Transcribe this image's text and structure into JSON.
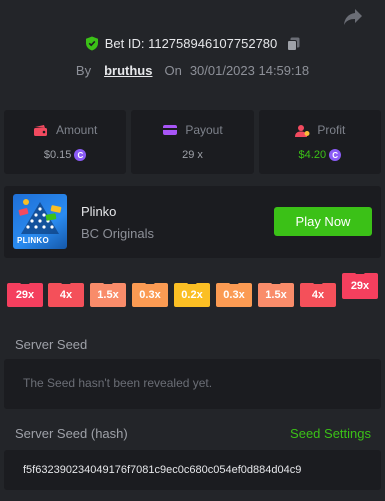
{
  "bet": {
    "id_label": "Bet ID: 112758946107752780",
    "by_label": "By",
    "username": "bruthus",
    "on_label": "On",
    "datetime": "30/01/2023 14:59:18"
  },
  "stats": [
    {
      "label": "Amount",
      "value": "$0.15",
      "coin": "C",
      "icon": "wallet-icon"
    },
    {
      "label": "Payout",
      "value": "29 x",
      "icon": "card-icon"
    },
    {
      "label": "Profit",
      "value": "$4.20",
      "coin": "C",
      "icon": "user-coin-icon"
    }
  ],
  "game": {
    "name": "Plinko",
    "provider": "BC Originals",
    "thumb_text": "PLINKO",
    "play_label": "Play Now"
  },
  "multipliers": [
    "29x",
    "4x",
    "1.5x",
    "0.3x",
    "0.2x",
    "0.3x",
    "1.5x",
    "4x",
    "29x"
  ],
  "multiplier_colors": [
    "#f43f5e",
    "#f4505a",
    "#f98c6a",
    "#fb9b53",
    "#fbbf24",
    "#fb9b53",
    "#f98c6a",
    "#f4505a",
    "#f43f5e"
  ],
  "multiplier_highlight_index": 8,
  "server_seed": {
    "label": "Server Seed",
    "message": "The Seed hasn't been revealed yet."
  },
  "server_seed_hash": {
    "label": "Server Seed (hash)",
    "settings_label": "Seed Settings",
    "value": "f5f632390234049176f7081c9ec0c680c054ef0d884d04c9"
  },
  "colors": {
    "accent_green": "#3bc117",
    "coin_purple": "#8b5cf6",
    "shield_green": "#3bc117"
  }
}
